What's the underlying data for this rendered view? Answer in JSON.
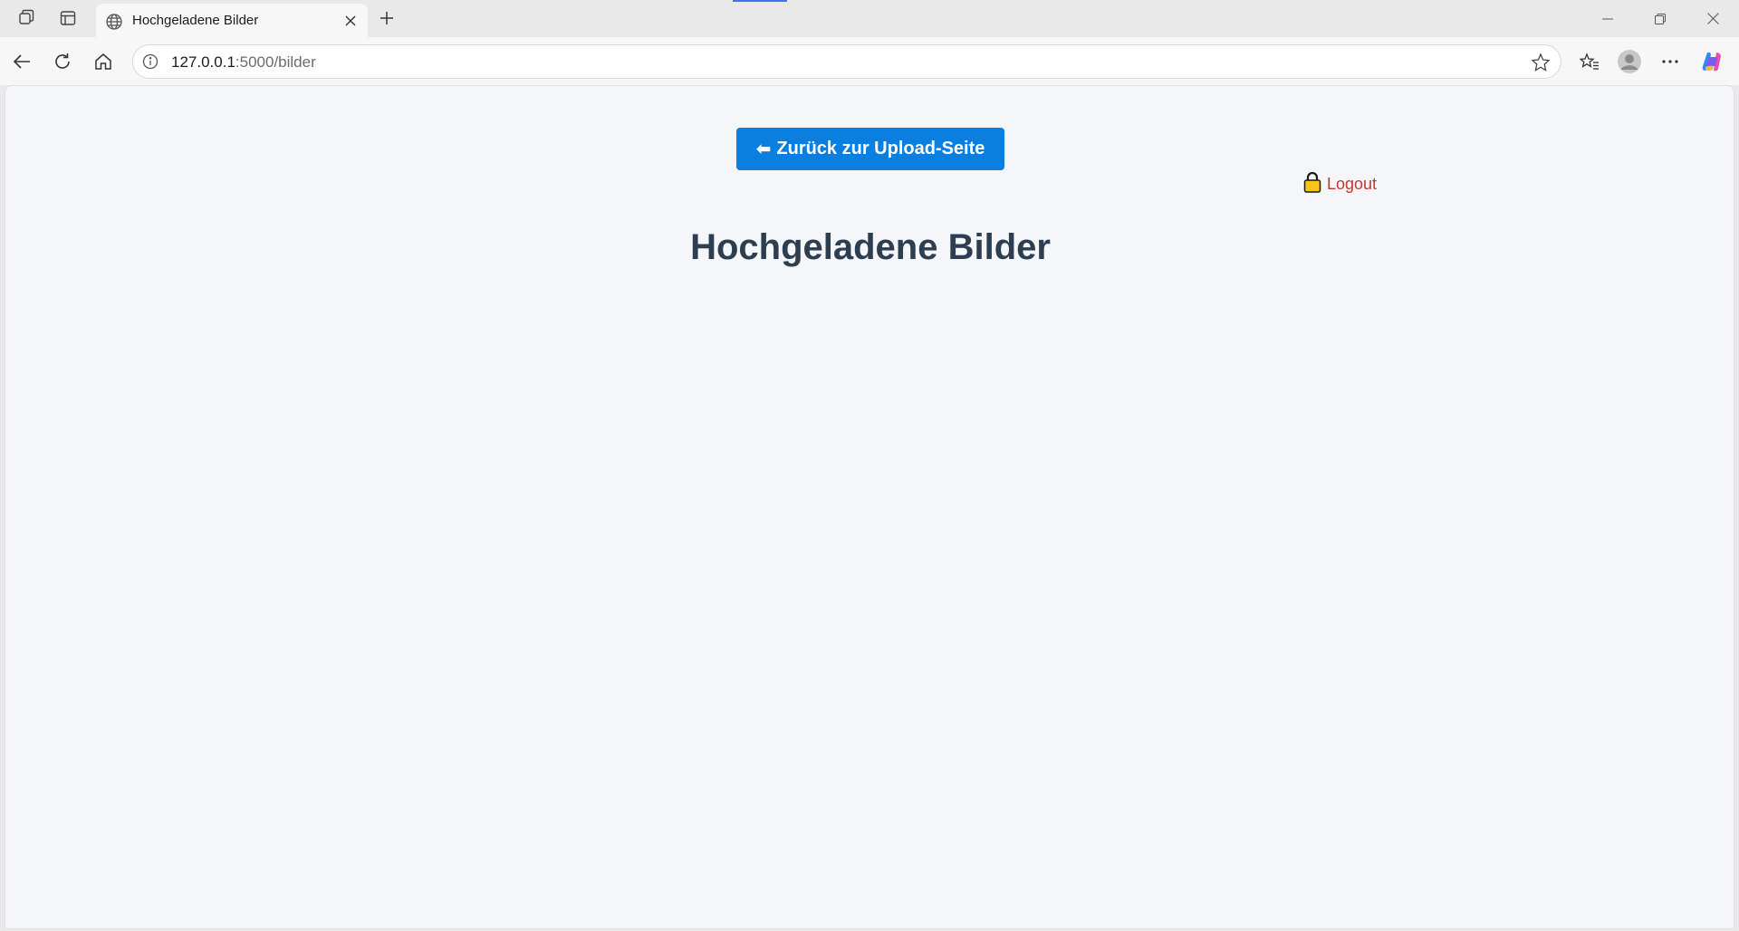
{
  "browser": {
    "tab": {
      "title": "Hochgeladene Bilder",
      "favicon": "globe-icon"
    },
    "address": {
      "url_host": "127.0.0.1",
      "url_rest": ":5000/bilder"
    }
  },
  "page": {
    "back_button": {
      "arrow": "⬅",
      "label": "Zurück zur Upload-Seite"
    },
    "logout": {
      "label": "Logout",
      "icon": "lock-icon"
    },
    "heading": "Hochgeladene Bilder"
  },
  "colors": {
    "primary_button": "#0b7fe0",
    "logout_text": "#c0392b",
    "heading": "#2c3e50",
    "page_background": "#f4f6f9"
  }
}
